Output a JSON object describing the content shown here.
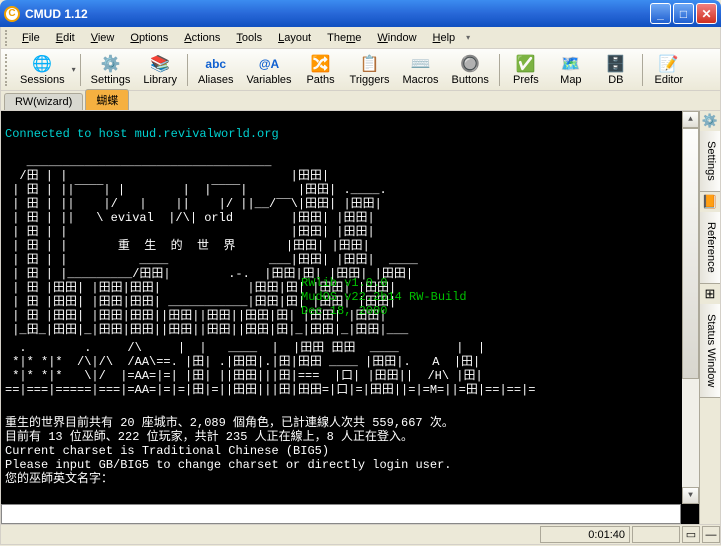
{
  "window": {
    "title": "CMUD 1.12"
  },
  "menu": {
    "file": "File",
    "edit": "Edit",
    "view": "View",
    "options": "Options",
    "actions": "Actions",
    "tools": "Tools",
    "layout": "Layout",
    "theme": "Theme",
    "window": "Window",
    "help": "Help"
  },
  "toolbar": {
    "sessions": "Sessions",
    "settings": "Settings",
    "library": "Library",
    "aliases": "Aliases",
    "variables": "Variables",
    "paths": "Paths",
    "triggers": "Triggers",
    "macros": "Macros",
    "buttons": "Buttons",
    "prefs": "Prefs",
    "map": "Map",
    "db": "DB",
    "editor": "Editor",
    "aliases_ico": "abc",
    "variables_ico": "@A"
  },
  "tabs": {
    "rw": "RW(wizard)",
    "active": "蝴蝶"
  },
  "side": {
    "settings": "Settings",
    "reference": "Reference",
    "status": "Status Window"
  },
  "status": {
    "time": "0:01:40"
  },
  "term": {
    "connect": "Connected to host mud.revivalworld.org",
    "art": "   __________________________________\n  /田 | |                               |田田|\n | 田 | ||‾‾‾‾| |        |  |‾‾‾‾|       |田田| .____.\n | 田 | ||    |/   |    ||    |/ ||__/‾‾\\|田田| |田田|\n | 田 | ||   \\ evival  |/\\| orld        |田田| |田田|\n | 田 | |                               |田田| |田田|\n | 田 | |       重  生  的  世  界       |田田| |田田|\n | 田 | |          ____              ___|田田| |田田|  ____\n | 田 | |_________/田田|        .-.  |田田|田| |田田| |田田|\n | 田 |田田| |田田|田田|            |田田|田| |田田| |田田|\n | 田 |田田| |田田|田田| ___________|田田|田| |田田| |田田|\n | 田 |田田| |田田|田田||田田||田田||田田|田| |田田| |田田|\n |_田_|田田|_|田田|田田||田田||田田||田田|田|_|田田|_|田田|___",
    "ver1": "RWlib v1.0.0",
    "ver2": "MudOS v22.2b14 RW-Build",
    "ver3": "Dec 18, 2000",
    "bottom": "  .        .     /\\     |  |   ____  |  |田田 田田  ____        |  |\n *|* *|*  /\\|/\\  /AA\\==. |田| .|田田|.|田|田田 ____ |田田|.   A  |田|\n *|* *|*   \\|/  |=AA=|=| |田| ||田田|||田|===  |口| |田田||  /H\\ |田|\n==|===|=====|===|=AA=|=|=|田|=||田田|||田|田田=|口|=|田田||=|=M=||=田|==|==|=\n",
    "info1": "重生的世界目前共有 20 座城市、2,089 個角色，已計連線人次共 559,667 次。",
    "info2": "目前有 13 位巫師、222 位玩家，共計 235 人正在線上，8 人正在登入。",
    "info3": "Current charset is Traditional Chinese (BIG5)",
    "info4": "Please input GB/BIG5 to change charset or directly login user.",
    "info5": "您的巫師英文名字："
  }
}
